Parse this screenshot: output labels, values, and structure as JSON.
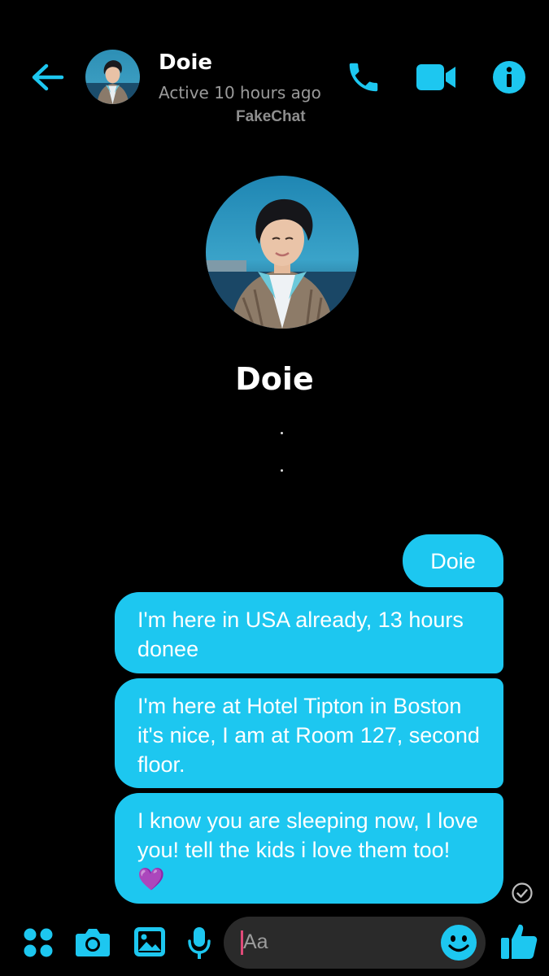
{
  "header": {
    "contact_name": "Doie",
    "status": "Active 10 hours ago",
    "watermark": "FakeChat"
  },
  "profile": {
    "name": "Doie"
  },
  "messages": [
    {
      "text": "Doie",
      "sender": "me"
    },
    {
      "text": "I'm here in USA already, 13 hours donee",
      "sender": "me"
    },
    {
      "text": "I'm here at Hotel Tipton in Boston it's nice, I am at Room 127, second floor.",
      "sender": "me"
    },
    {
      "text": "I know you are sleeping now, I love you! tell the kids i love them too! 💜",
      "sender": "me"
    }
  ],
  "composer": {
    "placeholder": "Aa"
  },
  "colors": {
    "accent": "#1dc7f0",
    "background": "#000000",
    "status_gray": "#9a9a9a",
    "composer_bg": "#2a2a2a"
  },
  "icons": [
    "back-arrow-icon",
    "phone-icon",
    "video-camera-icon",
    "info-icon",
    "seen-check-icon",
    "apps-icon",
    "camera-icon",
    "gallery-icon",
    "microphone-icon",
    "emoji-icon",
    "thumbs-up-icon"
  ]
}
